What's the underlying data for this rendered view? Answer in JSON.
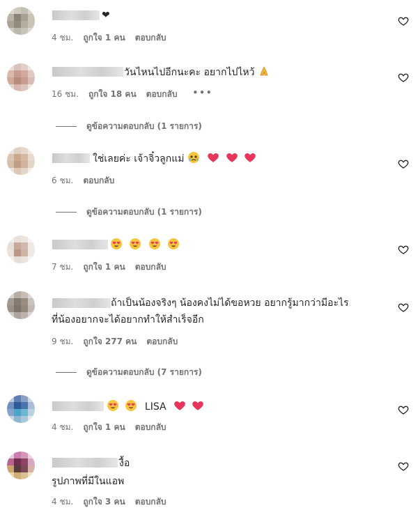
{
  "comments": [
    {
      "text": "❤",
      "time": "4 ชม.",
      "likes": "ถูกใจ 1 คน",
      "reply": "ตอบกลับ"
    },
    {
      "text": "วันไหนไปอีกนะคะ อยากไปไหว้",
      "emoji_suffix": "folded-hands-emoji",
      "time": "16 ชม.",
      "likes": "ถูกใจ 18 คน",
      "reply": "ตอบกลับ",
      "more": "•••",
      "view_replies": "ดูข้อความตอบกลับ (1 รายการ)"
    },
    {
      "text": "ใช่เลยค่ะ เจ้าจิ๋วลูกแม่",
      "time": "6 ชม.",
      "reply": "ตอบกลับ",
      "view_replies": "ดูข้อความตอบกลับ (1 รายการ)"
    },
    {
      "time": "7 ชม.",
      "likes": "ถูกใจ 1 คน",
      "reply": "ตอบกลับ"
    },
    {
      "text_line1": "ถ้าเป็นน้องจริงๆ น้องคงไม่ได้ขอหวย อยากรู้มากว่ามีอะไร",
      "text_line2": "ที่น้องอยากจะได้อยากทำให้สำเร็จอีก",
      "time": "9 ชม.",
      "likes": "ถูกใจ 277 คน",
      "reply": "ตอบกลับ",
      "view_replies": "ดูข้อความตอบกลับ (7 รายการ)"
    },
    {
      "text": "LISA",
      "time": "4 ชม.",
      "likes": "ถูกใจ 1 คน",
      "reply": "ตอบกลับ"
    },
    {
      "text": "งื้อ",
      "image_note": "รูปภาพที่มีในแอพ",
      "time": "4 ชม.",
      "likes": "ถูกใจ 3 คน",
      "reply": "ตอบกลับ"
    }
  ],
  "icons": {
    "like": "heart-outline-icon"
  }
}
